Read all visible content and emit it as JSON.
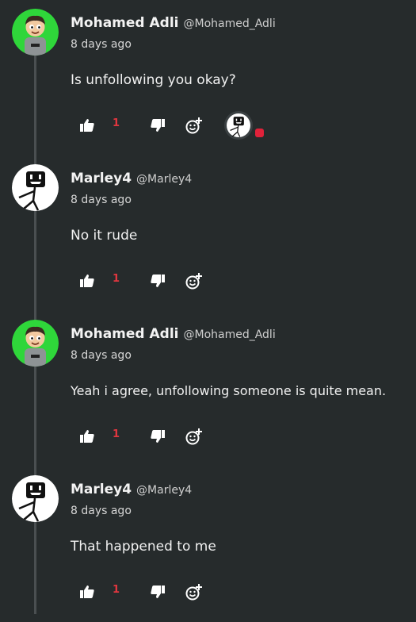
{
  "accent_color": "#e0363f",
  "comments": [
    {
      "author_name": "Mohamed Adli",
      "author_handle": "@Mohamed_Adli",
      "timestamp": "8 days ago",
      "text": "Is unfollowing you okay?",
      "avatar": "cartoon-boy-avatar",
      "like_count": "1",
      "has_reaction": true
    },
    {
      "author_name": "Marley4",
      "author_handle": "@Marley4",
      "timestamp": "8 days ago",
      "text": "No it rude",
      "avatar": "stickman-avatar",
      "like_count": "1",
      "has_reaction": false
    },
    {
      "author_name": "Mohamed Adli",
      "author_handle": "@Mohamed_Adli",
      "timestamp": "8 days ago",
      "text": "Yeah i agree, unfollowing someone is quite mean.",
      "avatar": "cartoon-boy-avatar",
      "like_count": "1",
      "has_reaction": false
    },
    {
      "author_name": "Marley4",
      "author_handle": "@Marley4",
      "timestamp": "8 days ago",
      "text": "That happened to me",
      "avatar": "stickman-avatar",
      "like_count": "1",
      "has_reaction": false
    }
  ]
}
